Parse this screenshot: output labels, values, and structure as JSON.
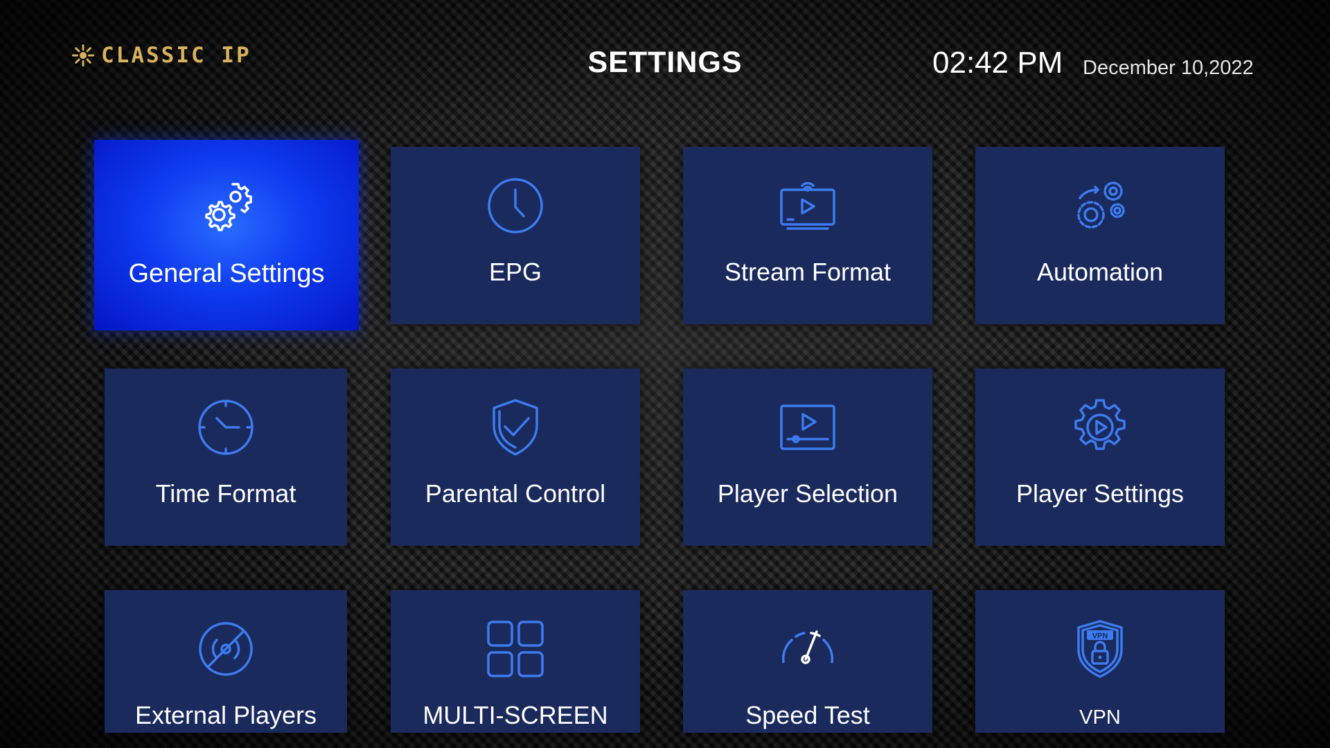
{
  "header": {
    "logo_text": "CLASSIC IP",
    "title": "SETTINGS",
    "time": "02:42 PM",
    "date": "December 10,2022"
  },
  "colors": {
    "tile_background": "#1a2a5c",
    "tile_selected": "#0e3bf0",
    "icon_blue": "#3c7bf0",
    "logo_gold": "#d8b15c"
  },
  "tiles": [
    {
      "label": "General Settings",
      "icon": "gears-icon",
      "selected": true
    },
    {
      "label": "EPG",
      "icon": "clock-icon",
      "selected": false
    },
    {
      "label": "Stream Format",
      "icon": "streaming-monitor-icon",
      "selected": false
    },
    {
      "label": "Automation",
      "icon": "automation-gears-icon",
      "selected": false
    },
    {
      "label": "Time Format",
      "icon": "timer-icon",
      "selected": false
    },
    {
      "label": "Parental Control",
      "icon": "shield-check-icon",
      "selected": false
    },
    {
      "label": "Player Selection",
      "icon": "video-player-icon",
      "selected": false
    },
    {
      "label": "Player Settings",
      "icon": "play-gear-icon",
      "selected": false
    },
    {
      "label": "External Players",
      "icon": "blocked-broadcast-icon",
      "selected": false
    },
    {
      "label": "MULTI-SCREEN",
      "icon": "grid-icon",
      "selected": false
    },
    {
      "label": "Speed Test",
      "icon": "speedometer-icon",
      "selected": false
    },
    {
      "label": "VPN",
      "icon": "vpn-shield-icon",
      "selected": false
    }
  ]
}
